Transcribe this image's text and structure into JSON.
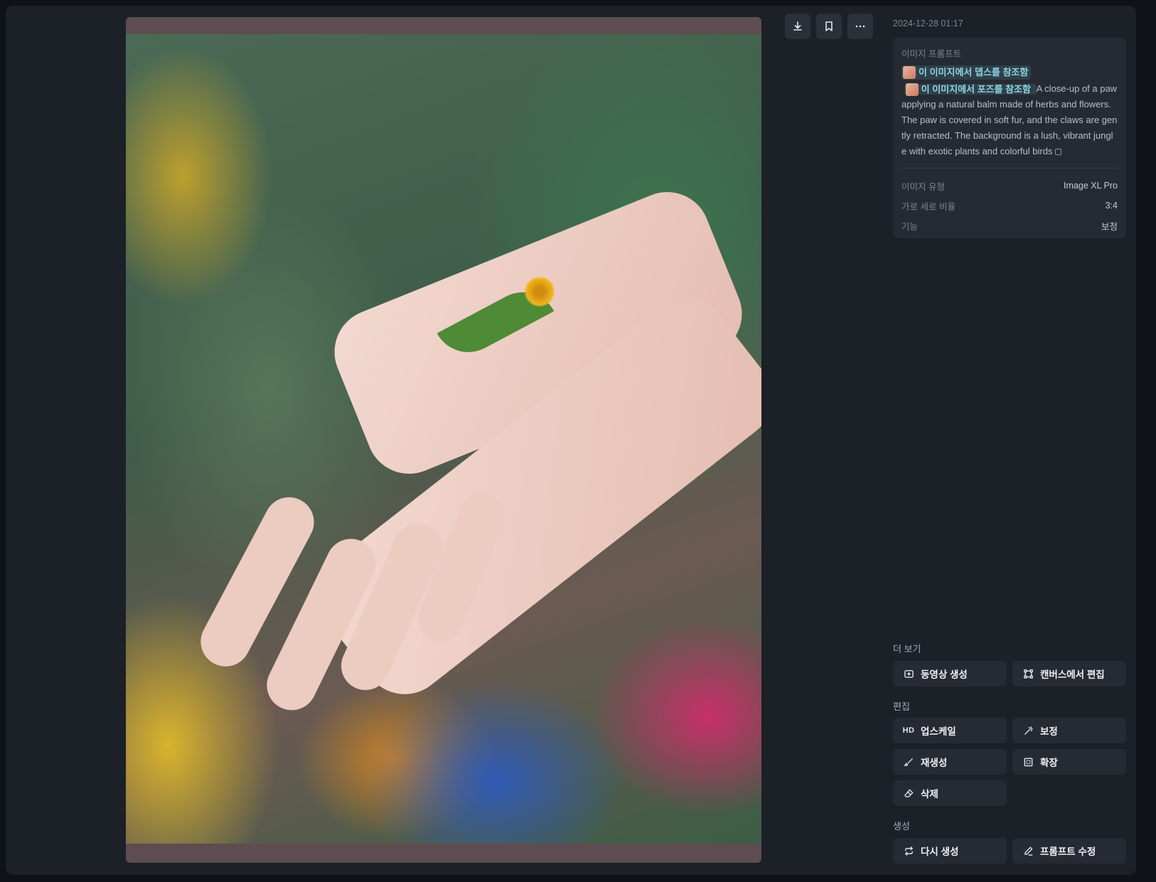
{
  "toolbar": {
    "download": "download-icon",
    "bookmark": "bookmark-icon",
    "more": "more-icon"
  },
  "details": {
    "timestamp": "2024-12-28 01:17",
    "prompt_label": "이미지 프롬프트",
    "ref_depth": "이 이미지에서 뎁스를 참조함",
    "ref_pose": "이 이미지에서 포즈를 참조함",
    "prompt": "A close-up of a paw applying a natural balm made of herbs and flowers. The paw is covered in soft fur, and the claws are gently retracted. The background is a lush, vibrant jungle with exotic plants and colorful birds",
    "meta": [
      {
        "key": "이미지 유형",
        "value": "Image XL Pro"
      },
      {
        "key": "가로 세로 비율",
        "value": "3:4"
      },
      {
        "key": "기능",
        "value": "보정"
      }
    ]
  },
  "sections": {
    "more": "더 보기",
    "edit": "편집",
    "generate": "생성"
  },
  "actions": {
    "video": "동영상 생성",
    "canvas": "캔버스에서 편집",
    "hd": "HD",
    "upscale": "업스케일",
    "retouch": "보정",
    "regenerate": "재생성",
    "expand": "확장",
    "erase": "삭제",
    "again": "다시 생성",
    "edit_prompt": "프롬프트 수정"
  }
}
